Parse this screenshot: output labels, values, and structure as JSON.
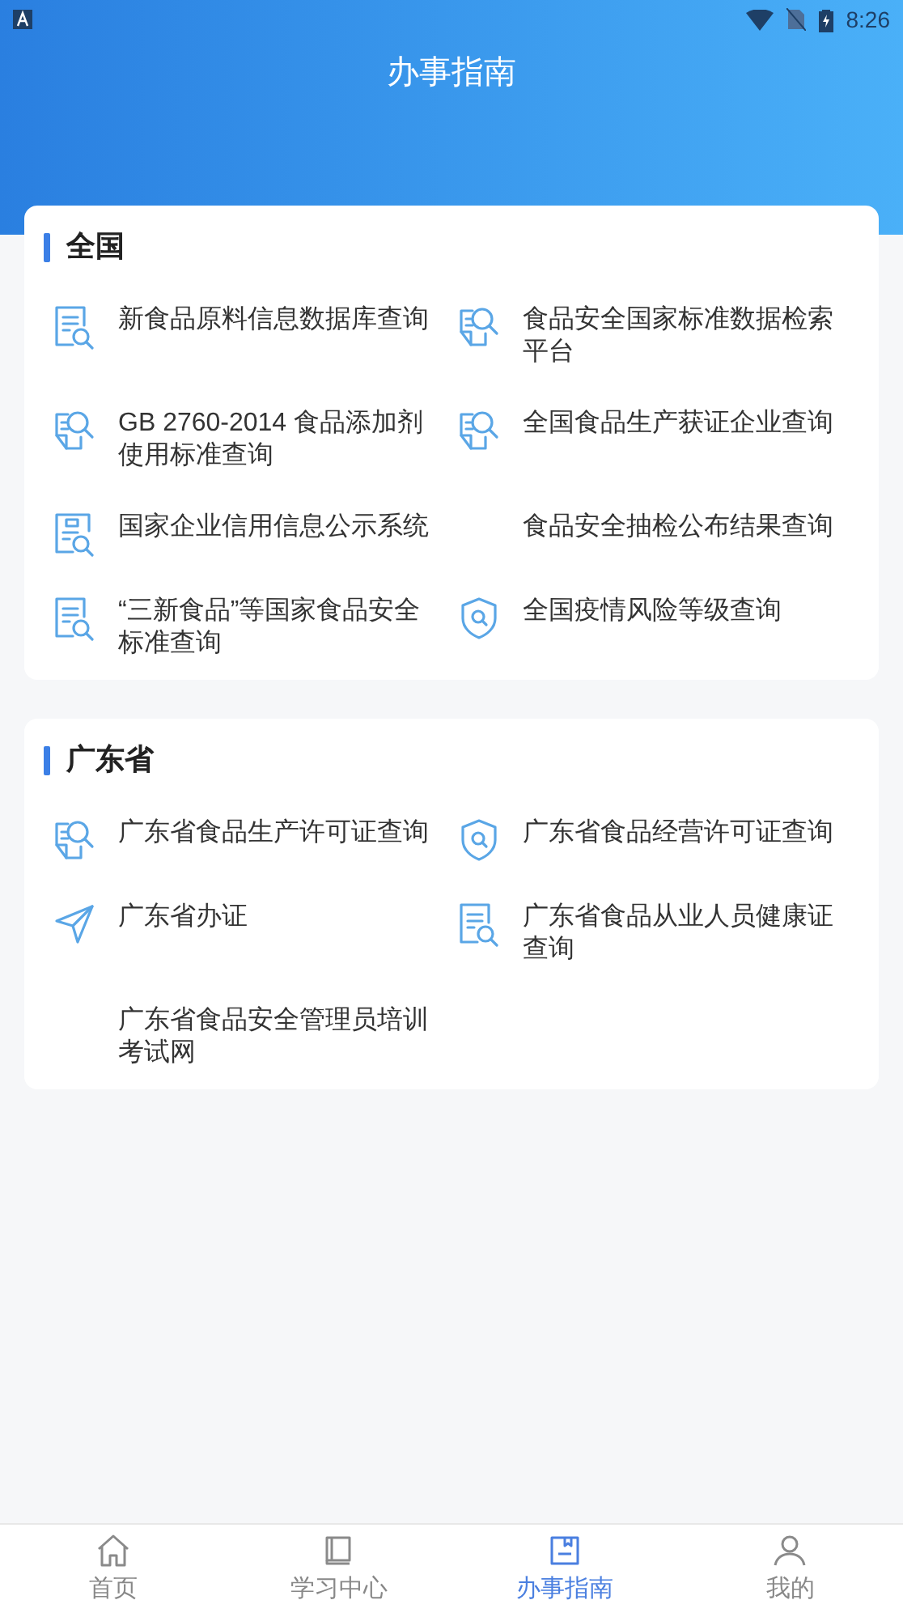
{
  "status_bar": {
    "time": "8:26"
  },
  "header": {
    "title": "办事指南"
  },
  "sections": [
    {
      "title": "全国",
      "items": [
        {
          "label": "新食品原料信息数据库查询",
          "kind": "doc-search"
        },
        {
          "label": "食品安全国家标准数据检索平台",
          "kind": "page-search"
        },
        {
          "label": "GB 2760-2014 食品添加剂使用标准查询",
          "kind": "page-search"
        },
        {
          "label": "全国食品生产获证企业查询",
          "kind": "page-search"
        },
        {
          "label": "国家企业信用信息公示系统",
          "kind": "register-search"
        },
        {
          "label": "食品安全抽检公布结果查询",
          "kind": "none"
        },
        {
          "label": "“三新食品”等国家食品安全标准查询",
          "kind": "doc-search"
        },
        {
          "label": "全国疫情风险等级查询",
          "kind": "shield-search"
        }
      ]
    },
    {
      "title": "广东省",
      "items": [
        {
          "label": "广东省食品生产许可证查询",
          "kind": "page-search"
        },
        {
          "label": "广东省食品经营许可证查询",
          "kind": "shield-search"
        },
        {
          "label": "广东省办证",
          "kind": "send"
        },
        {
          "label": "广东省食品从业人员健康证查询",
          "kind": "doc-search"
        },
        {
          "label": "广东省食品安全管理员培训考试网",
          "kind": "none"
        }
      ]
    }
  ],
  "tabs": [
    {
      "label": "首页",
      "kind": "home",
      "selected": false
    },
    {
      "label": "学习中心",
      "kind": "book",
      "selected": false
    },
    {
      "label": "办事指南",
      "kind": "guide",
      "selected": true
    },
    {
      "label": "我的",
      "kind": "user",
      "selected": false
    }
  ]
}
